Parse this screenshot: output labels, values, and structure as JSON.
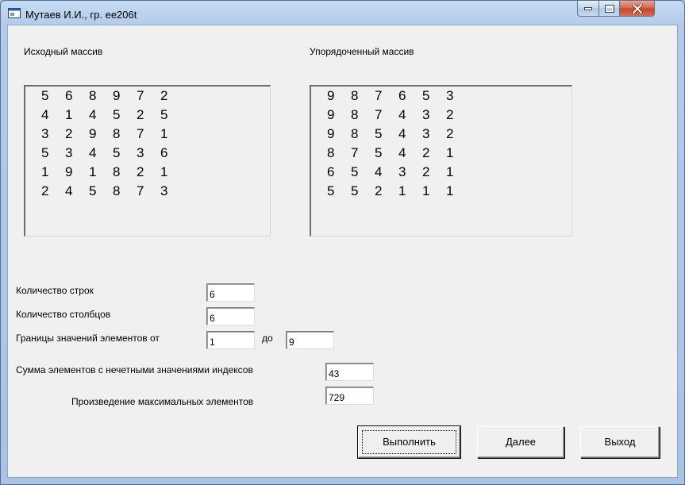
{
  "window": {
    "title": "Мутаев И.И., гр. ee206t"
  },
  "labels": {
    "source_array": "Исходный массив",
    "sorted_array": "Упорядоченный массив",
    "rows_count": "Количество строк",
    "cols_count": "Количество столбцов",
    "bounds_from": "Границы значений элементов от",
    "bounds_to": "до",
    "sum_odd": "Сумма элементов с нечетными значениями индексов",
    "product_max": "Произведение максимальных элементов"
  },
  "fields": {
    "rows": "6",
    "cols": "6",
    "min": "1",
    "max": "9",
    "sum": "43",
    "product": "729"
  },
  "buttons": {
    "execute": "Выполнить",
    "next": "Далее",
    "exit": "Выход"
  },
  "source_matrix": [
    [
      "5",
      "6",
      "8",
      "9",
      "7",
      "2"
    ],
    [
      "4",
      "1",
      "4",
      "5",
      "2",
      "5"
    ],
    [
      "3",
      "2",
      "9",
      "8",
      "7",
      "1"
    ],
    [
      "5",
      "3",
      "4",
      "5",
      "3",
      "6"
    ],
    [
      "1",
      "9",
      "1",
      "8",
      "2",
      "1"
    ],
    [
      "2",
      "4",
      "5",
      "8",
      "7",
      "3"
    ]
  ],
  "sorted_matrix": [
    [
      "9",
      "8",
      "7",
      "6",
      "5",
      "3"
    ],
    [
      "9",
      "8",
      "7",
      "4",
      "3",
      "2"
    ],
    [
      "9",
      "8",
      "5",
      "4",
      "3",
      "2"
    ],
    [
      "8",
      "7",
      "5",
      "4",
      "2",
      "1"
    ],
    [
      "6",
      "5",
      "4",
      "3",
      "2",
      "1"
    ],
    [
      "5",
      "5",
      "2",
      "1",
      "1",
      "1"
    ]
  ]
}
